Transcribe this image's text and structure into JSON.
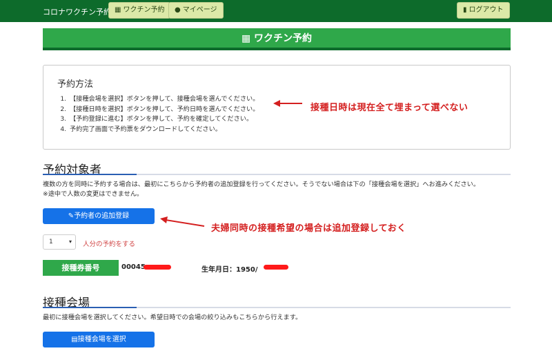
{
  "navbar": {
    "brand": "コロナワクチン予約",
    "vaccine_btn": "ワクチン予約",
    "mypage_btn": "マイページ",
    "logout_btn": "ログアウト"
  },
  "banner": {
    "title": "ワクチン予約"
  },
  "howto": {
    "title": "予約方法",
    "steps": [
      "【接種会場を選択】ボタンを押して、接種会場を選んでください。",
      "【接種日時を選択】ボタンを押して、予約日時を選んでください。",
      "【予約登録に進む】ボタンを押して、予約を確定してください。",
      "予約完了画面で予約票をダウンロードしてください。"
    ]
  },
  "reservee": {
    "title": "予約対象者",
    "desc1": "複数の方を同時に予約する場合は、最初にこちらから予約者の追加登録を行ってください。そうでない場合は下の「接種会場を選択」へお進みください。",
    "desc2": "※途中で人数の変更はできません。",
    "add_btn": "予約者の追加登録",
    "count_value": "1",
    "count_label": "人分の予約をする",
    "ticket_label": "接種券番号",
    "ticket_value": "00045",
    "dob_label": "生年月日：1950/"
  },
  "venue": {
    "title": "接種会場",
    "desc": "最初に接種会場を選択してください。希望日時での会場の絞り込みもこちらから行えます。",
    "select_btn": "接種会場を選択"
  },
  "annotations": {
    "note1": "接種日時は現在全て埋まって選べない",
    "note2": "夫婦同時の接種希望の場合は追加登録しておく"
  },
  "colors": {
    "navbar": "#0d6b2b",
    "green_accent": "#2fa84a",
    "primary_button": "#1572e8",
    "annotation": "#d41f1f"
  }
}
